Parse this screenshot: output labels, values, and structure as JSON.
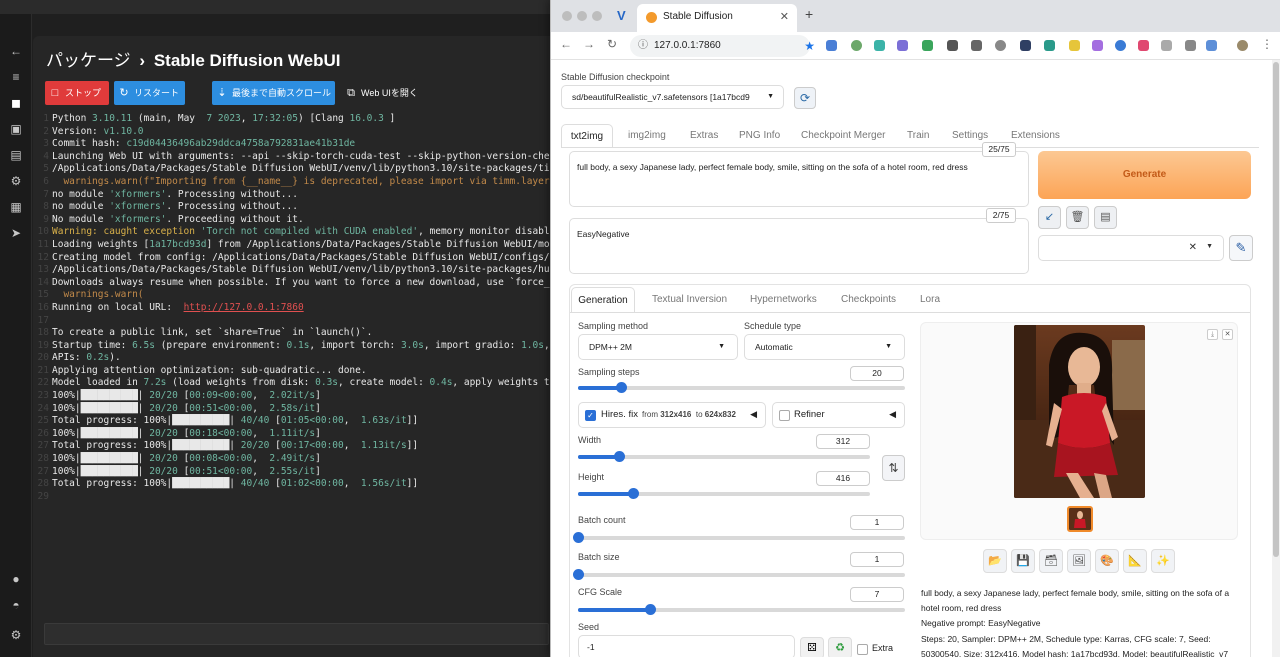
{
  "left_app": {
    "breadcrumb_parent": "パッケージ",
    "breadcrumb_sep": "›",
    "breadcrumb_current": "Stable Diffusion WebUI",
    "buttons": {
      "stop": "ストップ",
      "restart": "リスタート",
      "autoscroll": "最後まで自動スクロール",
      "open_webui": "Web UIを開く"
    },
    "console_lines": [
      {
        "n": "1",
        "segs": [
          [
            "Python ",
            "gr"
          ],
          [
            "3.10.11",
            "g"
          ],
          [
            " (main, May  ",
            "gr"
          ],
          [
            "7 2023",
            "g"
          ],
          [
            ", ",
            "gr"
          ],
          [
            "17:32:05",
            "g"
          ],
          [
            ") [Clang ",
            "gr"
          ],
          [
            "16.0.3",
            "g"
          ],
          [
            " ]",
            "gr"
          ]
        ]
      },
      {
        "n": "2",
        "segs": [
          [
            "Version: ",
            "gr"
          ],
          [
            "v1.10.0",
            "g"
          ]
        ]
      },
      {
        "n": "3",
        "segs": [
          [
            "Commit hash: ",
            "gr"
          ],
          [
            "c19d04436496ab29ddca4758a792831ae41b31de",
            "g"
          ]
        ]
      },
      {
        "n": "4",
        "segs": [
          [
            "Launching Web UI with arguments: --api --skip-torch-cuda-test --skip-python-version-check",
            "gr"
          ]
        ]
      },
      {
        "n": "5",
        "segs": [
          [
            "/Applications/Data/Packages/Stable Diffusion WebUI/venv/lib/python3.10/site-packages/timm",
            "gr"
          ]
        ]
      },
      {
        "n": "6",
        "segs": [
          [
            "  warnings.warn(f\"Importing from {__name__} is deprecated, please import via timm.layers\"",
            "y"
          ]
        ]
      },
      {
        "n": "7",
        "segs": [
          [
            "no module ",
            "gr"
          ],
          [
            "'xformers'",
            "g"
          ],
          [
            ". Processing without...",
            "gr"
          ]
        ]
      },
      {
        "n": "8",
        "segs": [
          [
            "no module ",
            "gr"
          ],
          [
            "'xformers'",
            "g"
          ],
          [
            ". Processing without...",
            "gr"
          ]
        ]
      },
      {
        "n": "9",
        "segs": [
          [
            "No module ",
            "gr"
          ],
          [
            "'xformers'",
            "g"
          ],
          [
            ". Proceeding without it.",
            "gr"
          ]
        ]
      },
      {
        "n": "10",
        "segs": [
          [
            "Warning: caught exception ",
            "yel"
          ],
          [
            "'Torch not compiled with CUDA enabled'",
            "g"
          ],
          [
            ", memory monitor disabled",
            "gr"
          ]
        ]
      },
      {
        "n": "11",
        "segs": [
          [
            "Loading weights [",
            "gr"
          ],
          [
            "1a17bcd93d",
            "g"
          ],
          [
            "] from /Applications/Data/Packages/Stable Diffusion WebUI/mode",
            "gr"
          ]
        ]
      },
      {
        "n": "12",
        "segs": [
          [
            "Creating model from config: /Applications/Data/Packages/Stable Diffusion WebUI/configs/v1",
            "gr"
          ]
        ]
      },
      {
        "n": "13",
        "segs": [
          [
            "/Applications/Data/Packages/Stable Diffusion WebUI/venv/lib/python3.10/site-packages/hugg",
            "gr"
          ]
        ]
      },
      {
        "n": "14",
        "segs": [
          [
            "Downloads always resume when possible. If you want to force a new download, use `force_do",
            "gr"
          ]
        ]
      },
      {
        "n": "15",
        "segs": [
          [
            "  warnings.warn(",
            "y"
          ]
        ]
      },
      {
        "n": "16",
        "segs": [
          [
            "Running on local URL:  ",
            "gr"
          ],
          [
            "http://127.0.0.1:7860",
            "link"
          ]
        ]
      },
      {
        "n": "17",
        "segs": []
      },
      {
        "n": "18",
        "segs": [
          [
            "To create a public link, set `share=True` in `launch()`.",
            "gr"
          ]
        ]
      },
      {
        "n": "19",
        "segs": [
          [
            "Startup time: ",
            "gr"
          ],
          [
            "6.5s",
            "g"
          ],
          [
            " (prepare environment: ",
            "gr"
          ],
          [
            "0.1s",
            "g"
          ],
          [
            ", import torch: ",
            "gr"
          ],
          [
            "3.0s",
            "g"
          ],
          [
            ", import gradio: ",
            "gr"
          ],
          [
            "1.0s",
            "g"
          ],
          [
            ", s",
            "gr"
          ]
        ]
      },
      {
        "n": "20",
        "segs": [
          [
            "APIs: ",
            "gr"
          ],
          [
            "0.2s",
            "g"
          ],
          [
            ").",
            "gr"
          ]
        ]
      },
      {
        "n": "21",
        "segs": [
          [
            "Applying attention optimization: sub-quadratic... done.",
            "gr"
          ]
        ]
      },
      {
        "n": "22",
        "segs": [
          [
            "Model loaded in ",
            "gr"
          ],
          [
            "7.2s",
            "g"
          ],
          [
            " (load weights from disk: ",
            "gr"
          ],
          [
            "0.3s",
            "g"
          ],
          [
            ", create model: ",
            "gr"
          ],
          [
            "0.4s",
            "g"
          ],
          [
            ", apply weights to",
            "gr"
          ]
        ]
      },
      {
        "n": "23",
        "segs": [
          [
            "100%|██████████| ",
            "gr"
          ],
          [
            "20/20",
            "g"
          ],
          [
            " [",
            "gr"
          ],
          [
            "00:09<00:00",
            "g"
          ],
          [
            ",  ",
            "gr"
          ],
          [
            "2.02it/s",
            "g"
          ],
          [
            "]",
            "gr"
          ]
        ]
      },
      {
        "n": "24",
        "segs": [
          [
            "100%|██████████| ",
            "gr"
          ],
          [
            "20/20",
            "g"
          ],
          [
            " [",
            "gr"
          ],
          [
            "00:51<00:00",
            "g"
          ],
          [
            ",  ",
            "gr"
          ],
          [
            "2.58s/it",
            "g"
          ],
          [
            "]",
            "gr"
          ]
        ]
      },
      {
        "n": "25",
        "segs": [
          [
            "Total progress: 100%|██████████| ",
            "gr"
          ],
          [
            "40/40",
            "g"
          ],
          [
            " [",
            "gr"
          ],
          [
            "01:05<00:00",
            "g"
          ],
          [
            ",  ",
            "gr"
          ],
          [
            "1.63s/it",
            "g"
          ],
          [
            "]]",
            "gr"
          ]
        ]
      },
      {
        "n": "26",
        "segs": [
          [
            "100%|██████████| ",
            "gr"
          ],
          [
            "20/20",
            "g"
          ],
          [
            " [",
            "gr"
          ],
          [
            "00:18<00:00",
            "g"
          ],
          [
            ",  ",
            "gr"
          ],
          [
            "1.11it/s",
            "g"
          ],
          [
            "]",
            "gr"
          ]
        ]
      },
      {
        "n": "27",
        "segs": [
          [
            "Total progress: 100%|██████████| ",
            "gr"
          ],
          [
            "20/20",
            "g"
          ],
          [
            " [",
            "gr"
          ],
          [
            "00:17<00:00",
            "g"
          ],
          [
            ",  ",
            "gr"
          ],
          [
            "1.13it/s",
            "g"
          ],
          [
            "]]",
            "gr"
          ]
        ]
      },
      {
        "n": "28",
        "segs": [
          [
            "100%|██████████| ",
            "gr"
          ],
          [
            "20/20",
            "g"
          ],
          [
            " [",
            "gr"
          ],
          [
            "00:08<00:00",
            "g"
          ],
          [
            ",  ",
            "gr"
          ],
          [
            "2.49it/s",
            "g"
          ],
          [
            "]",
            "gr"
          ]
        ]
      },
      {
        "n": "27",
        "segs": [
          [
            "100%|██████████| ",
            "gr"
          ],
          [
            "20/20",
            "g"
          ],
          [
            " [",
            "gr"
          ],
          [
            "00:51<00:00",
            "g"
          ],
          [
            ",  ",
            "gr"
          ],
          [
            "2.55s/it",
            "g"
          ],
          [
            "]",
            "gr"
          ]
        ]
      },
      {
        "n": "28",
        "segs": [
          [
            "Total progress: 100%|██████████| ",
            "gr"
          ],
          [
            "40/40",
            "g"
          ],
          [
            " [",
            "gr"
          ],
          [
            "01:02<00:00",
            "g"
          ],
          [
            ",  ",
            "gr"
          ],
          [
            "1.56s/it",
            "g"
          ],
          [
            "]]",
            "gr"
          ]
        ]
      },
      {
        "n": "29",
        "segs": []
      }
    ]
  },
  "browser": {
    "tab_title": "Stable Diffusion",
    "url": "127.0.0.1:7860"
  },
  "webui": {
    "checkpoint_label": "Stable Diffusion checkpoint",
    "checkpoint_value": "sd/beautifulRealistic_v7.safetensors [1a17bcd9",
    "main_tabs": [
      "txt2img",
      "img2img",
      "Extras",
      "PNG Info",
      "Checkpoint Merger",
      "Train",
      "Settings",
      "Extensions"
    ],
    "positive_prompt": "full body, a sexy Japanese lady, perfect female body, smile, sitting on the sofa of a hotel room, red dress",
    "positive_tokens": "25/75",
    "negative_prompt": "EasyNegative",
    "negative_tokens": "2/75",
    "generate": "Generate",
    "sub_tabs": [
      "Generation",
      "Textual Inversion",
      "Hypernetworks",
      "Checkpoints",
      "Lora"
    ],
    "sampling_method_label": "Sampling method",
    "sampling_method": "DPM++ 2M",
    "schedule_type_label": "Schedule type",
    "schedule_type": "Automatic",
    "sampling_steps_label": "Sampling steps",
    "sampling_steps": "20",
    "sampling_steps_level": 0.13,
    "hires_label": "Hires. fix",
    "hires_from": "from",
    "hires_from_val": "312x416",
    "hires_to": "to",
    "hires_to_val": "624x832",
    "refiner_label": "Refiner",
    "width_label": "Width",
    "width": "312",
    "width_level": 0.14,
    "height_label": "Height",
    "height": "416",
    "height_level": 0.19,
    "batch_count_label": "Batch count",
    "batch_count": "1",
    "batch_count_level": 0.0,
    "batch_size_label": "Batch size",
    "batch_size": "1",
    "batch_size_level": 0.0,
    "cfg_label": "CFG Scale",
    "cfg": "7",
    "cfg_level": 0.22,
    "seed_label": "Seed",
    "seed": "-1",
    "extra_label": "Extra",
    "info_prompt": "full body, a sexy Japanese lady, perfect female body, smile, sitting on the sofa of a hotel room, red dress",
    "info_negative": "Negative prompt: EasyNegative",
    "info_params": "Steps: 20, Sampler: DPM++ 2M, Schedule type: Karras, CFG scale: 7, Seed: 50300540, Size: 312x416, Model hash: 1a17bcd93d, Model: beautifulRealistic_v7"
  },
  "colors": {
    "accent": "#2a6fd6",
    "generate_top": "#fcc893",
    "generate_bottom": "#fca456",
    "stop": "#e03b3b",
    "restart": "#2d8ee0"
  }
}
